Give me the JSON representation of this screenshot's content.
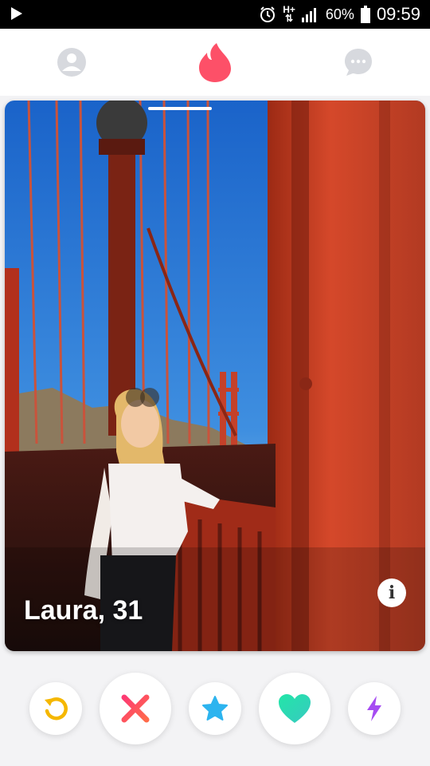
{
  "status_bar": {
    "battery": "60%",
    "time": "09:59",
    "network": "H+"
  },
  "nav": {
    "profile_icon": "profile-icon",
    "home_icon": "flame-icon",
    "messages_icon": "chat-icon",
    "accent_color": "#fd5068"
  },
  "card": {
    "name_age": "Laura, 31",
    "info_icon": "i",
    "photo_index": 1
  },
  "actions": [
    {
      "name": "rewind",
      "icon": "rewind-icon",
      "color": "#f5b700"
    },
    {
      "name": "nope",
      "icon": "x-icon",
      "color": "#fd4b6e"
    },
    {
      "name": "super-like",
      "icon": "star-icon",
      "color": "#2db4ef"
    },
    {
      "name": "like",
      "icon": "heart-icon",
      "color": "#2fd9b2"
    },
    {
      "name": "boost",
      "icon": "bolt-icon",
      "color": "#a64cf2"
    }
  ]
}
